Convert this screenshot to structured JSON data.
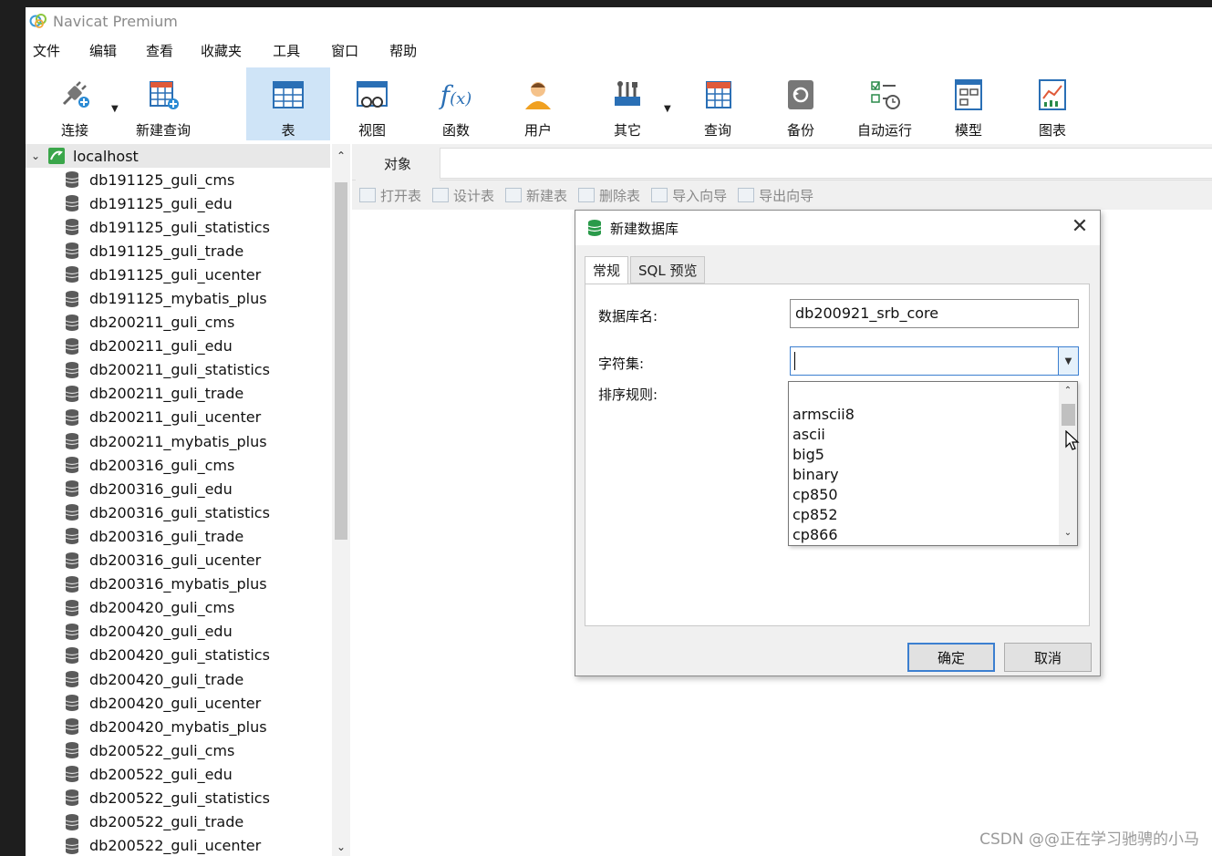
{
  "window": {
    "title": "Navicat Premium"
  },
  "menu": [
    "文件",
    "编辑",
    "查看",
    "收藏夹",
    "工具",
    "窗口",
    "帮助"
  ],
  "toolbar": [
    {
      "label": "连接",
      "icon": "plug-connect-icon",
      "caret": true
    },
    {
      "label": "新建查询",
      "icon": "new-query-icon"
    },
    {
      "label": "表",
      "icon": "table-icon",
      "active": true
    },
    {
      "label": "视图",
      "icon": "view-icon"
    },
    {
      "label": "函数",
      "icon": "function-icon"
    },
    {
      "label": "用户",
      "icon": "user-icon"
    },
    {
      "label": "其它",
      "icon": "tools-icon",
      "caret": true
    },
    {
      "label": "查询",
      "icon": "query-icon"
    },
    {
      "label": "备份",
      "icon": "backup-icon"
    },
    {
      "label": "自动运行",
      "icon": "schedule-icon"
    },
    {
      "label": "模型",
      "icon": "model-icon"
    },
    {
      "label": "图表",
      "icon": "chart-icon"
    }
  ],
  "tree": {
    "root": "localhost",
    "databases": [
      "db191125_guli_cms",
      "db191125_guli_edu",
      "db191125_guli_statistics",
      "db191125_guli_trade",
      "db191125_guli_ucenter",
      "db191125_mybatis_plus",
      "db200211_guli_cms",
      "db200211_guli_edu",
      "db200211_guli_statistics",
      "db200211_guli_trade",
      "db200211_guli_ucenter",
      "db200211_mybatis_plus",
      "db200316_guli_cms",
      "db200316_guli_edu",
      "db200316_guli_statistics",
      "db200316_guli_trade",
      "db200316_guli_ucenter",
      "db200316_mybatis_plus",
      "db200420_guli_cms",
      "db200420_guli_edu",
      "db200420_guli_statistics",
      "db200420_guli_trade",
      "db200420_guli_ucenter",
      "db200420_mybatis_plus",
      "db200522_guli_cms",
      "db200522_guli_edu",
      "db200522_guli_statistics",
      "db200522_guli_trade",
      "db200522_guli_ucenter"
    ]
  },
  "objects": {
    "tab": "对象",
    "tools": [
      "打开表",
      "设计表",
      "新建表",
      "删除表",
      "导入向导",
      "导出向导"
    ]
  },
  "dialog": {
    "title": "新建数据库",
    "tabs": [
      "常规",
      "SQL 预览"
    ],
    "name_label": "数据库名:",
    "name_value": "db200921_srb_core",
    "charset_label": "字符集:",
    "charset_value": "",
    "collation_label": "排序规则:",
    "charset_options": [
      "armscii8",
      "ascii",
      "big5",
      "binary",
      "cp850",
      "cp852",
      "cp866"
    ],
    "ok": "确定",
    "cancel": "取消"
  },
  "watermark": "CSDN @@正在学习驰骋的小马",
  "colors": {
    "accent": "#3c7fd0",
    "active_tool": "#cfe4f7",
    "db_icon": "#5a5a5a"
  }
}
